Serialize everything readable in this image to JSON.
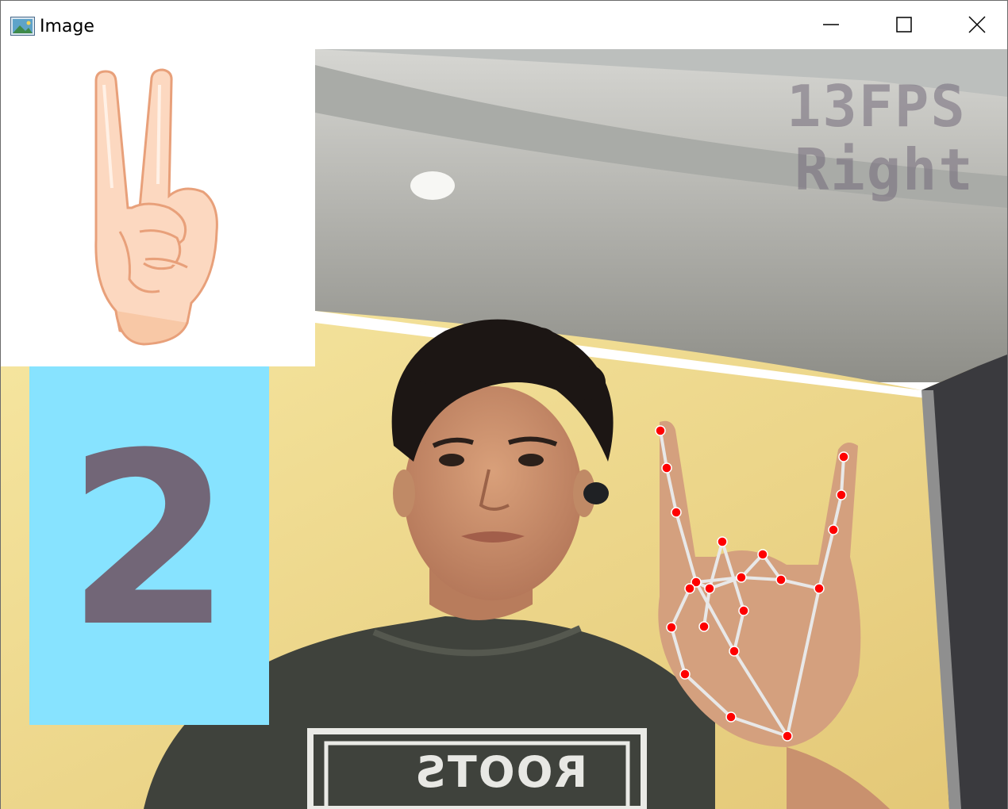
{
  "window": {
    "title": "Image",
    "minimize_symbol": "—",
    "maximize_symbol": "□",
    "close_symbol": "✕"
  },
  "overlay": {
    "fps": "13FPS",
    "hand": "Right"
  },
  "finger_count": {
    "value": "2"
  },
  "shirt": {
    "text": "ROOTS"
  },
  "colors": {
    "count_panel_bg": "#87e3ff",
    "count_digit": "#726677",
    "landmark": "#ff0000",
    "connection": "#e8e8e8",
    "overlay_text": "#736a7a"
  },
  "icons": {
    "app": "image-app-icon",
    "gesture": "peace-sign-hand-icon"
  }
}
